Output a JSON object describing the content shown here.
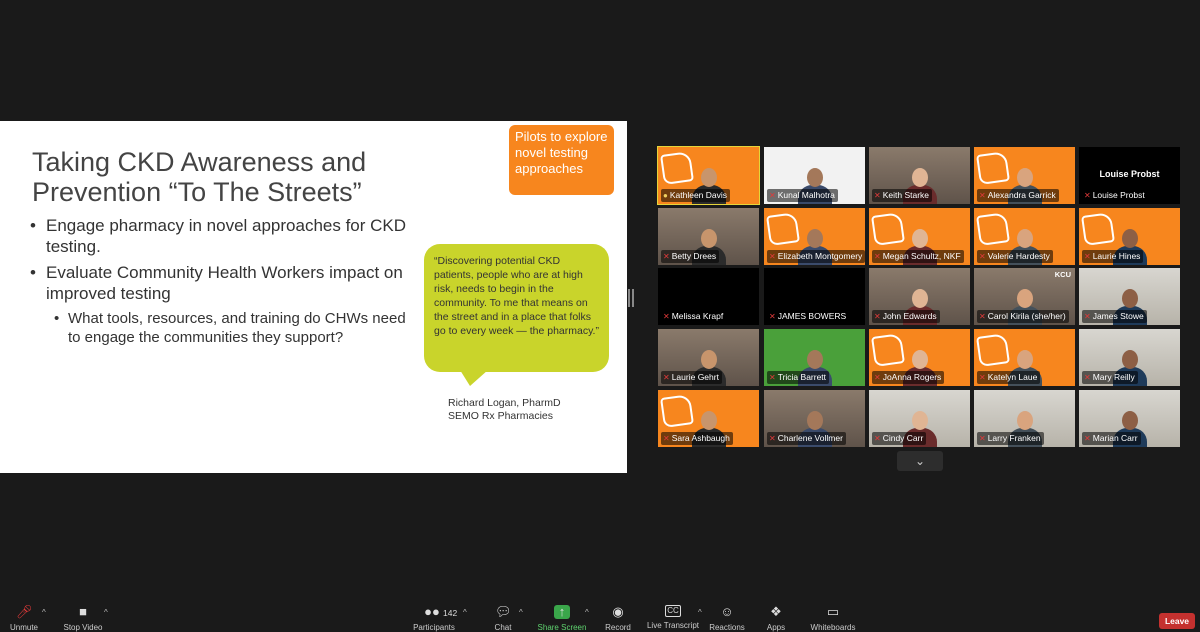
{
  "slide": {
    "title": "Taking CKD Awareness and Prevention “To The Streets”",
    "callout": "Pilots to explore novel testing approaches",
    "bullets": [
      "Engage pharmacy in novel approaches for CKD testing.",
      "Evaluate Community Health Workers impact on improved testing"
    ],
    "sub_bullets": [
      "What tools, resources, and training do CHWs need to engage the communities they support?"
    ],
    "quote": "“Discovering potential CKD patients, people who are at high risk, needs to begin in the community.  To me that means on the street and in a place that folks go to every week — the pharmacy.”",
    "attribution_name": "Richard Logan, PharmD",
    "attribution_org": "SEMO Rx Pharmacies"
  },
  "gallery": {
    "participants": [
      {
        "name": "Kathleen Davis",
        "muted": false,
        "active_speaker": true,
        "bg": "orange"
      },
      {
        "name": "Kunal Malhotra",
        "muted": true,
        "bg": "white"
      },
      {
        "name": "Keith Starke",
        "muted": true,
        "bg": "office"
      },
      {
        "name": "Alexandra Garrick",
        "muted": true,
        "bg": "orange"
      },
      {
        "name": "Louise Probst",
        "muted": true,
        "bg": "black",
        "video_off": true
      },
      {
        "name": "Betty Drees",
        "muted": true,
        "bg": "office"
      },
      {
        "name": "Elizabeth Montgomery",
        "muted": true,
        "bg": "orange"
      },
      {
        "name": "Megan Schultz, NKF",
        "muted": true,
        "bg": "orange"
      },
      {
        "name": "Valerie Hardesty",
        "muted": true,
        "bg": "orange"
      },
      {
        "name": "Laurie Hines",
        "muted": true,
        "bg": "orange"
      },
      {
        "name": "Melissa Krapf",
        "muted": true,
        "bg": "black"
      },
      {
        "name": "JAMES BOWERS",
        "muted": true,
        "bg": "black"
      },
      {
        "name": "John Edwards",
        "muted": true,
        "bg": "office"
      },
      {
        "name": "Carol Kirila (she/her)",
        "muted": true,
        "bg": "office",
        "badge": "KCU"
      },
      {
        "name": "James Stowe",
        "muted": true,
        "bg": "light"
      },
      {
        "name": "Laurie Gehrt",
        "muted": true,
        "bg": "office"
      },
      {
        "name": "Tricia Barrett",
        "muted": true,
        "bg": "green"
      },
      {
        "name": "JoAnna Rogers",
        "muted": true,
        "bg": "orange"
      },
      {
        "name": "Katelyn Laue",
        "muted": true,
        "bg": "orange"
      },
      {
        "name": "Mary Reilly",
        "muted": true,
        "bg": "light"
      },
      {
        "name": "Sara Ashbaugh",
        "muted": true,
        "bg": "orange"
      },
      {
        "name": "Charlene Vollmer",
        "muted": true,
        "bg": "office"
      },
      {
        "name": "Cindy Carr",
        "muted": true,
        "bg": "light"
      },
      {
        "name": "Larry Franken",
        "muted": true,
        "bg": "light"
      },
      {
        "name": "Marian Carr",
        "muted": true,
        "bg": "light"
      }
    ]
  },
  "toolbar": {
    "unmute": "Unmute",
    "stop_video": "Stop Video",
    "participants": "Participants",
    "participant_count": "142",
    "chat": "Chat",
    "share_screen": "Share Screen",
    "record": "Record",
    "live_transcript": "Live Transcript",
    "reactions": "Reactions",
    "apps": "Apps",
    "whiteboards": "Whiteboards",
    "leave": "Leave"
  },
  "colors": {
    "accent_orange": "#f7861e",
    "quote_green": "#c9d42b",
    "leave_red": "#c4312f",
    "share_green": "#3aa64a",
    "active_speaker": "#e5d53a"
  }
}
